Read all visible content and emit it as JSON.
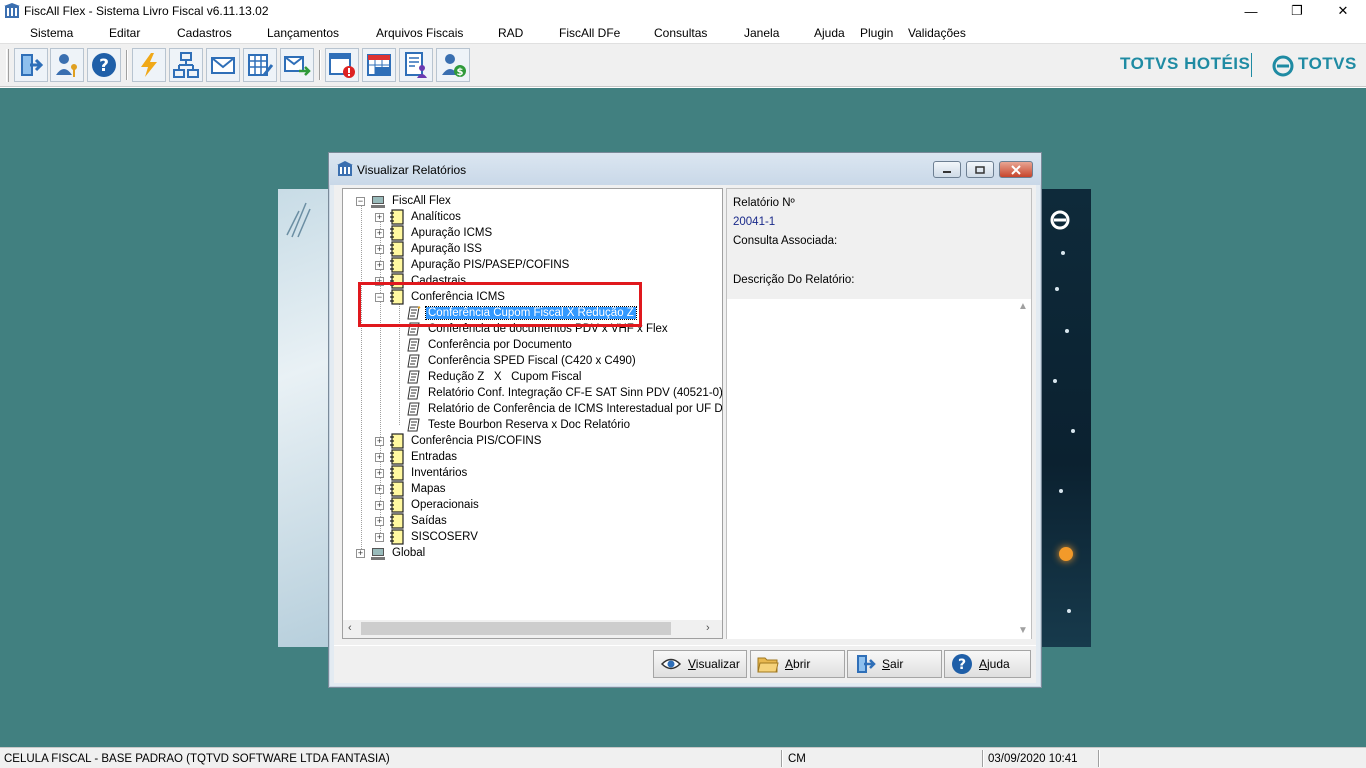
{
  "window": {
    "title": "FiscAll Flex - Sistema Livro Fiscal v6.11.13.02",
    "minimize": "—",
    "restore": "❐",
    "close": "✕"
  },
  "menu": [
    "Sistema",
    "Editar",
    "Cadastros",
    "Lançamentos",
    "Arquivos Fiscais",
    "RAD",
    "FiscAll DFe",
    "Consultas",
    "Janela",
    "Ajuda",
    "Plugin",
    "Validações"
  ],
  "toolbar": {
    "buttons": [
      "exit-icon",
      "user-key-icon",
      "help-icon",
      "lightning-icon",
      "network-icon",
      "envelope-icon",
      "spreadsheet-edit-icon",
      "send-mail-icon",
      "window-alert-icon",
      "icms-calendar-icon",
      "document-user-icon",
      "user-money-icon"
    ]
  },
  "brand": {
    "hotel": "TOTVS HOTÉIS",
    "totvs": "TOTVS",
    "color": "#1f8ba3"
  },
  "dialog": {
    "title": "Visualizar Relatórios",
    "tree": {
      "root": "FiscAll Flex",
      "groups": [
        "Analíticos",
        "Apuração ICMS",
        "Apuração ISS",
        "Apuração PIS/PASEP/COFINS",
        "Cadastrais"
      ],
      "expanded_group": "Conferência ICMS",
      "children": [
        "Conferência Cupom Fiscal X Redução Z",
        "Conferência de documentos PDV x VHF x Flex",
        "Conferência por Documento",
        "Conferência SPED Fiscal (C420 x C490)",
        "Redução Z   X   Cupom Fiscal",
        "Relatório Conf. Integração CF-E SAT Sinn PDV (40521-0)",
        "Relatório de Conferência de ICMS Interestadual por UF D",
        "Teste Bourbon Reserva x Doc Relatório"
      ],
      "groups_after": [
        "Conferência PIS/COFINS",
        "Entradas",
        "Inventários",
        "Mapas",
        "Operacionais",
        "Saídas",
        "SISCOSERV"
      ],
      "global": "Global"
    },
    "info": {
      "report_no_label": "Relatório Nº",
      "report_no": "20041-1",
      "query_label": "Consulta Associada:",
      "desc_label": "Descrição Do Relatório:"
    },
    "buttons": {
      "view": "Visualizar",
      "open": "Abrir",
      "exit": "Sair",
      "help": "Ajuda"
    }
  },
  "status": {
    "company": "CELULA FISCAL - BASE PADRAO (TQTVD SOFTWARE LTDA FANTASIA)",
    "mode": "CM",
    "datetime": "03/09/2020 10:41"
  }
}
